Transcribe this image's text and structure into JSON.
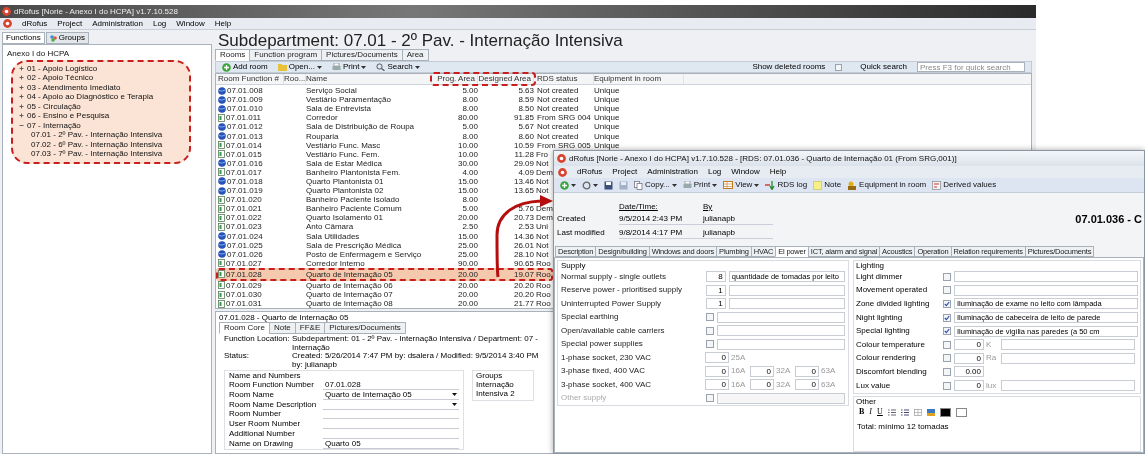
{
  "main_window": {
    "title": "dRofus [Norie - Anexo I do HCPA] v1.7.10.528",
    "menu": [
      "dRofus",
      "Project",
      "Administration",
      "Log",
      "Window",
      "Help"
    ]
  },
  "navigator": {
    "tabs": [
      {
        "label": "Functions",
        "selected": true
      },
      {
        "label": "Groups",
        "selected": false
      }
    ],
    "tree": [
      {
        "label": "Anexo I do HCPA",
        "children": [
          {
            "label": "01 - Apoio Logístico",
            "expanded": false
          },
          {
            "label": "02 - Apoio Técnico",
            "expanded": false
          },
          {
            "label": "03 - Atendimento Imediato",
            "expanded": false
          },
          {
            "label": "04 - Apoio ao Diagnóstico e Terapia",
            "expanded": false
          },
          {
            "label": "05 - Circulação",
            "expanded": false
          },
          {
            "label": "06 - Ensino e Pesquisa",
            "expanded": false
          },
          {
            "label": "07 - Internação",
            "expanded": true,
            "children": [
              {
                "label": "07.01 - 2º Pav. - Internação Intensiva"
              },
              {
                "label": "07.02 - 6º Pav. - Internação Intensiva"
              },
              {
                "label": "07.03 - 7º Pav. - Internação Intensiva"
              }
            ]
          }
        ]
      }
    ]
  },
  "subdepartment": {
    "title": "Subdepartment: 07.01 - 2º Pav. - Internação Intensiva",
    "tabs": [
      {
        "label": "Rooms",
        "selected": true
      },
      {
        "label": "Function program",
        "selected": false
      },
      {
        "label": "Pictures/Documents",
        "selected": false
      },
      {
        "label": "Area",
        "selected": false
      }
    ],
    "toolbar": [
      {
        "label": "Add room",
        "kind": "add",
        "dropdown": false
      },
      {
        "label": "Open...",
        "kind": "open",
        "dropdown": true
      },
      {
        "label": "Print",
        "kind": "print",
        "dropdown": true
      },
      {
        "label": "Search",
        "kind": "search",
        "dropdown": true
      }
    ],
    "show_deleted_rooms": {
      "label": "Show deleted rooms",
      "checked": false
    },
    "quick_search": {
      "label": "Quick search",
      "placeholder": "Press F3 for quick search"
    },
    "columns": [
      "Room Function #",
      "Roo...",
      "Name",
      "Prog. Area",
      "Designed Area",
      "RDS status",
      "Equipment in room"
    ],
    "rows": [
      {
        "number": "07.01.008",
        "kind": "globe",
        "name": "Serviço Social",
        "prog_area": "5.00",
        "designed_area": "5.63",
        "rds_status": "Not created",
        "equipment": "Unique",
        "selected": false
      },
      {
        "number": "07.01.009",
        "kind": "globe",
        "name": "Vestiário Paramentação",
        "prog_area": "8.00",
        "designed_area": "8.59",
        "rds_status": "Not created",
        "equipment": "Unique",
        "selected": false
      },
      {
        "number": "07.01.010",
        "kind": "globe",
        "name": "Sala de Entrevista",
        "prog_area": "8.00",
        "designed_area": "8.50",
        "rds_status": "Not created",
        "equipment": "Unique",
        "selected": false
      },
      {
        "number": "07.01.011",
        "kind": "sheet",
        "name": "Corredor",
        "prog_area": "80.00",
        "designed_area": "91.85",
        "rds_status": "From SRG 004",
        "equipment": "Unique",
        "selected": false
      },
      {
        "number": "07.01.012",
        "kind": "globe",
        "name": "Sala de Distribuição de Roupa",
        "prog_area": "5.00",
        "designed_area": "5.67",
        "rds_status": "Not created",
        "equipment": "Unique",
        "selected": false
      },
      {
        "number": "07.01.013",
        "kind": "globe",
        "name": "Rouparia",
        "prog_area": "8.00",
        "designed_area": "8.60",
        "rds_status": "Not created",
        "equipment": "Unique",
        "selected": false
      },
      {
        "number": "07.01.014",
        "kind": "sheet",
        "name": "Vestiário Func. Masc",
        "prog_area": "10.00",
        "designed_area": "10.59",
        "rds_status": "From SRG 005",
        "equipment": "Unique",
        "selected": false
      },
      {
        "number": "07.01.015",
        "kind": "sheet",
        "name": "Vestiário Func. Fem.",
        "prog_area": "10.00",
        "designed_area": "11.28",
        "rds_status": "Fro",
        "selected": false
      },
      {
        "number": "07.01.016",
        "kind": "globe",
        "name": "Sala de Estar Médica",
        "prog_area": "30.00",
        "designed_area": "29.09",
        "rds_status": "Not",
        "selected": false
      },
      {
        "number": "07.01.017",
        "kind": "sheet",
        "name": "Banheiro Plantonista Fem.",
        "prog_area": "4.00",
        "designed_area": "4.09",
        "rds_status": "Dem",
        "selected": false
      },
      {
        "number": "07.01.018",
        "kind": "globe",
        "name": "Quarto Plantonista 01",
        "prog_area": "15.00",
        "designed_area": "13.46",
        "rds_status": "Not",
        "selected": false
      },
      {
        "number": "07.01.019",
        "kind": "globe",
        "name": "Quarto Plantonista 02",
        "prog_area": "15.00",
        "designed_area": "13.65",
        "rds_status": "Not",
        "selected": false
      },
      {
        "number": "07.01.020",
        "kind": "sheet",
        "name": "Banheiro Paciente Isolado",
        "prog_area": "8.00",
        "selected": false
      },
      {
        "number": "07.01.021",
        "kind": "sheet",
        "name": "Banheiro Paciente Comum",
        "prog_area": "5.00",
        "designed_area": "5.76",
        "rds_status": "Dem",
        "selected": false
      },
      {
        "number": "07.01.022",
        "kind": "sheet",
        "name": "Quarto Isolamento 01",
        "prog_area": "20.00",
        "designed_area": "20.73",
        "rds_status": "Dem",
        "selected": false
      },
      {
        "number": "07.01.023",
        "kind": "sheet",
        "name": "Anto Câmara",
        "prog_area": "2.50",
        "designed_area": "2.53",
        "rds_status": "Uni",
        "selected": false
      },
      {
        "number": "07.01.024",
        "kind": "globe",
        "name": "Sala Utilidades",
        "prog_area": "15.00",
        "designed_area": "14.36",
        "rds_status": "Not",
        "selected": false
      },
      {
        "number": "07.01.025",
        "kind": "globe",
        "name": "Sala de Prescrição Médica",
        "prog_area": "25.00",
        "designed_area": "26.01",
        "rds_status": "Not",
        "selected": false
      },
      {
        "number": "07.01.026",
        "kind": "globe",
        "name": "Posto de Enfermagem e Serviço",
        "prog_area": "25.00",
        "designed_area": "28.10",
        "rds_status": "Not",
        "selected": false
      },
      {
        "number": "07.01.027",
        "kind": "sheet",
        "name": "Corredor Interno",
        "prog_area": "90.00",
        "designed_area": "90.65",
        "rds_status": "Roo",
        "selected": false
      },
      {
        "number": "07.01.028",
        "kind": "sheet",
        "name": "Quarto de Internação 05",
        "prog_area": "20.00",
        "designed_area": "19.07",
        "rds_status": "Roo",
        "selected": true
      },
      {
        "number": "07.01.029",
        "kind": "sheet",
        "name": "Quarto de Internação 06",
        "prog_area": "20.00",
        "designed_area": "20.20",
        "rds_status": "Roo",
        "selected": false
      },
      {
        "number": "07.01.030",
        "kind": "sheet",
        "name": "Quarto de Internação 07",
        "prog_area": "20.00",
        "designed_area": "20.20",
        "rds_status": "Roo",
        "selected": false
      },
      {
        "number": "07.01.031",
        "kind": "sheet",
        "name": "Quarto de Internação 08",
        "prog_area": "20.00",
        "designed_area": "21.77",
        "rds_status": "Roo",
        "selected": false
      }
    ]
  },
  "room_detail": {
    "title": "07.01.028 - Quarto de Internação 05",
    "tabs": [
      {
        "label": "Room Core",
        "selected": true
      },
      {
        "label": "Note",
        "selected": false
      },
      {
        "label": "FF&E",
        "selected": false
      },
      {
        "label": "Pictures/Documents",
        "selected": false
      }
    ],
    "info": [
      {
        "label": "Function Location:",
        "value": "Subdepartment: 01 - 2º Pav. - Internação Intensiva / Department: 07 - Internação"
      },
      {
        "label": "Status:",
        "value": "Created: 5/26/2014 7:47 PM by: dsalera / Modified: 9/5/2014 3:40 PM by: julianapb"
      }
    ],
    "name_group": {
      "title": "Name and Numbers",
      "fields": [
        {
          "label": "Room Function Number",
          "value": "07.01.028",
          "dropdown": false
        },
        {
          "label": "Room Name",
          "value": "Quarto de Internação 05",
          "dropdown": true
        },
        {
          "label": "Room Name Description",
          "dropdown": true
        },
        {
          "label": "Room Number",
          "dropdown": false
        },
        {
          "label": "User Room Number",
          "dropdown": false
        },
        {
          "label": "Additional Number",
          "dropdown": false
        },
        {
          "label": "Name on Drawing",
          "value": "Quarto 05",
          "dropdown": false
        }
      ]
    },
    "groups": {
      "title": "Groups",
      "value": "Internação Intensiva 2"
    }
  },
  "rds_window": {
    "title": "dRofus [Norie - Anexo I do HCPA]  v1.7.10.528 - [RDS: 07.01.036 - Quarto de Internação 01 (From SRG,001)]",
    "menu": [
      "dRofus",
      "Project",
      "Administration",
      "Log",
      "Window",
      "Help"
    ],
    "toolbar": [
      {
        "kind": "add",
        "dropdown": true,
        "disabled": false
      },
      {
        "kind": "refresh",
        "dropdown": true,
        "disabled": false
      },
      {
        "kind": "save",
        "dropdown": false,
        "disabled": false
      },
      {
        "kind": "save",
        "dropdown": false,
        "disabled": true
      },
      {
        "label": "Copy...",
        "kind": "copy",
        "dropdown": true,
        "disabled": false
      },
      {
        "label": "Print",
        "kind": "print",
        "dropdown": true,
        "disabled": false
      },
      {
        "label": "View",
        "kind": "view",
        "dropdown": true,
        "disabled": false
      },
      {
        "label": "RDS log",
        "kind": "log",
        "dropdown": false,
        "disabled": false
      },
      {
        "label": "Note",
        "kind": "note",
        "dropdown": false,
        "disabled": false
      },
      {
        "label": "Equipment in room",
        "kind": "equipment",
        "dropdown": false,
        "disabled": false
      },
      {
        "label": "Derived values",
        "kind": "derived",
        "dropdown": false,
        "disabled": false
      }
    ],
    "history": {
      "headers": [
        "Date/Time:",
        "By"
      ],
      "rows": [
        {
          "label": "Created",
          "date": "9/5/2014 2:43 PM",
          "by": "julianapb"
        },
        {
          "label": "Last modified",
          "date": "9/8/2014 4:17 PM",
          "by": "julianapb"
        }
      ]
    },
    "heading": "07.01.036 - C",
    "tabs": [
      {
        "label": "Description",
        "selected": false
      },
      {
        "label": "Design/building",
        "selected": false
      },
      {
        "label": "Windows and doors",
        "selected": false
      },
      {
        "label": "Plumbing",
        "selected": false
      },
      {
        "label": "HVAC",
        "selected": false
      },
      {
        "label": "El power",
        "selected": true
      },
      {
        "label": "ICT, alarm and signal",
        "selected": false
      },
      {
        "label": "Acoustics",
        "selected": false
      },
      {
        "label": "Operation",
        "selected": false
      },
      {
        "label": "Relation requirements",
        "selected": false
      },
      {
        "label": "Pictures/Documents",
        "selected": false
      }
    ],
    "supply": {
      "title": "Supply",
      "rows": [
        {
          "kind": "number",
          "label": "Normal supply - single outlets",
          "value": "8",
          "note": "quantidade de tomadas por leito",
          "disabled": false
        },
        {
          "kind": "number",
          "label": "Reserve power - prioritised supply",
          "value": "1",
          "disabled": false
        },
        {
          "kind": "number",
          "label": "Uninterrupted Power Supply",
          "value": "1",
          "disabled": false
        },
        {
          "kind": "check",
          "label": "Special earthing",
          "checked": false,
          "disabled": false
        },
        {
          "kind": "check",
          "label": "Open/available cable carriers",
          "checked": false,
          "disabled": false
        },
        {
          "kind": "check",
          "label": "Special power supplies",
          "checked": false,
          "disabled": false
        },
        {
          "kind": "sockets",
          "label": "1-phase socket, 230 VAC",
          "sockets": [
            {
              "value": "0",
              "unit": "25A"
            }
          ],
          "disabled": false
        },
        {
          "kind": "sockets",
          "label": "3-phase fixed, 400 VAC",
          "sockets": [
            {
              "value": "0",
              "unit": "16A"
            },
            {
              "value": "0",
              "unit": "32A"
            },
            {
              "value": "0",
              "unit": "63A"
            }
          ],
          "disabled": false
        },
        {
          "kind": "sockets",
          "label": "3-phase socket, 400 VAC",
          "sockets": [
            {
              "value": "0",
              "unit": "16A"
            },
            {
              "value": "0",
              "unit": "32A"
            },
            {
              "value": "0",
              "unit": "63A"
            }
          ],
          "disabled": false
        },
        {
          "kind": "check",
          "label": "Other supply",
          "checked": false,
          "disabled": true
        }
      ]
    },
    "lighting": {
      "title": "Lighting",
      "rows": [
        {
          "kind": "check",
          "label": "Light dimmer",
          "checked": false
        },
        {
          "kind": "check",
          "label": "Movement operated",
          "checked": false
        },
        {
          "kind": "check",
          "label": "Zone divided lighting",
          "checked": true,
          "note": "Iluminação de exame no leito com lâmpada"
        },
        {
          "kind": "check",
          "label": "Night lighting",
          "checked": true,
          "note": "Iluminação de cabeceira de leito de parede"
        },
        {
          "kind": "check",
          "label": "Special lighting",
          "checked": true,
          "note": "Iluminação de vigília nas paredes (a 50 cm"
        },
        {
          "kind": "measure",
          "label": "Colour temperature",
          "checked": false,
          "value": "0",
          "unit": "K"
        },
        {
          "kind": "measure",
          "label": "Colour rendering",
          "checked": false,
          "value": "0",
          "unit": "Ra"
        },
        {
          "kind": "measure",
          "label": "Discomfort blending",
          "checked": false,
          "value": "0.00"
        },
        {
          "kind": "measure",
          "label": "Lux value",
          "checked": false,
          "value": "0",
          "unit": "lux"
        }
      ]
    },
    "other": {
      "title": "Other",
      "format_buttons": [
        "B",
        "I",
        "U"
      ],
      "text": "Total: mínimo 12 tomadas"
    }
  }
}
